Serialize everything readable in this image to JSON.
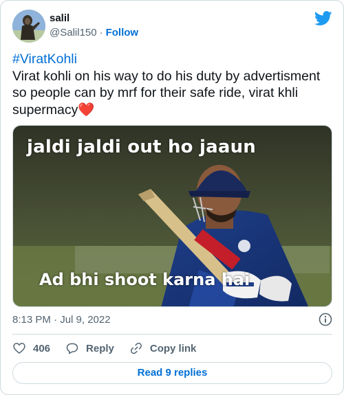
{
  "author": {
    "name": "salil",
    "handle": "@Salil150",
    "separator": "·",
    "follow_label": "Follow"
  },
  "tweet": {
    "hashtag": "#ViratKohli",
    "body": "Virat kohli on his way to do his duty by advertisment so people can by mrf for their safe ride, virat khli supermacy",
    "emoji": "❤️"
  },
  "media": {
    "caption_top": "jaldi jaldi out ho jaaun",
    "caption_bottom": "Ad bhi shoot karna hai"
  },
  "meta": {
    "timestamp": "8:13 PM · Jul 9, 2022"
  },
  "actions": {
    "like_count": "406",
    "reply_label": "Reply",
    "copy_label": "Copy link"
  },
  "footer": {
    "read_replies_label": "Read 9 replies"
  },
  "colors": {
    "accent": "#006fd6",
    "twitter_blue": "#1d9bf0",
    "heart": "#e0245e",
    "muted": "#536471",
    "border": "#cfd9de"
  },
  "icons": {
    "logo": "twitter-bird-icon",
    "info": "info-icon",
    "like": "heart-icon",
    "reply": "reply-bubble-icon",
    "copy": "link-icon"
  }
}
